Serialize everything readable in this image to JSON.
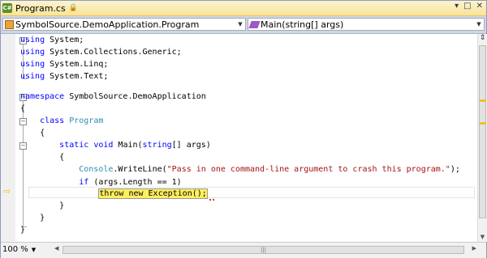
{
  "tab": {
    "title": "Program.cs",
    "icon": "csharp-file-icon",
    "lock": "lock-icon"
  },
  "window_buttons": [
    "▾",
    "□",
    "✕"
  ],
  "navbar": {
    "class_combo": "SymbolSource.DemoApplication.Program",
    "member_combo": "Main(string[] args)"
  },
  "code": {
    "l1": {
      "kw": "using",
      "rest": " System;"
    },
    "l2": {
      "kw": "using",
      "rest": " System.Collections.Generic;"
    },
    "l3": {
      "kw": "using",
      "rest": " System.Linq;"
    },
    "l4": {
      "kw": "using",
      "rest": " System.Text;"
    },
    "l6": {
      "kw": "namespace",
      "rest": " SymbolSource.DemoApplication"
    },
    "l7": "{",
    "l8": {
      "kw": "class",
      "type": " Program"
    },
    "l9": "{",
    "l10": {
      "kw1": "static",
      "kw2": " void",
      "name": " Main(",
      "kw3": "string",
      "rest": "[] args)"
    },
    "l11": "{",
    "l12": {
      "type": "Console",
      "call": ".WriteLine(",
      "str": "\"Pass in one command-line argument to crash this program.\"",
      "end": ");"
    },
    "l14": {
      "kw": "if",
      "rest": " (args.Length == 1)"
    },
    "l15": "throw new Exception();",
    "l16": "}",
    "l17": "}",
    "l18": "}"
  },
  "zoom": "100 %",
  "colors": {
    "keyword": "#0000ff",
    "type": "#2b91af",
    "string": "#a31515",
    "highlight": "#ffef5f"
  }
}
